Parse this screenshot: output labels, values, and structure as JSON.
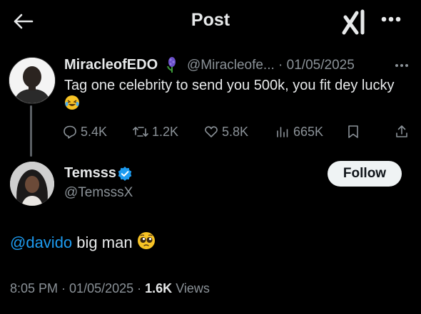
{
  "header": {
    "title": "Post",
    "back_icon": "arrow-left-icon",
    "grok_icon": "grok-icon",
    "more_icon": "more-horizontal-icon"
  },
  "parent_tweet": {
    "display_name": "MiracleofEDO",
    "badge_icon": "hyacinth-flower-emoji",
    "handle": "@Miracleofe...",
    "separator": " · ",
    "date": "01/05/2025",
    "text": "Tag one celebrity to send you 500k, you fit dey lucky",
    "text_emoji": "😂",
    "replies": "5.4K",
    "retweets": "1.2K",
    "likes": "5.8K",
    "views": "665K"
  },
  "reply_tweet": {
    "display_name": "Temsss",
    "verified": true,
    "handle": "@TemsssX",
    "follow_label": "Follow",
    "mention": "@davido",
    "text": " big man",
    "text_emoji": "🥺",
    "time": "8:05 PM",
    "separator": " · ",
    "date": "01/05/2025",
    "views_count": "1.6K",
    "views_label": "Views"
  },
  "colors": {
    "background": "#000000",
    "text": "#e7e9ea",
    "muted": "#8b9298",
    "accent": "#1d9bf0",
    "follow_bg": "#eff3f4"
  }
}
